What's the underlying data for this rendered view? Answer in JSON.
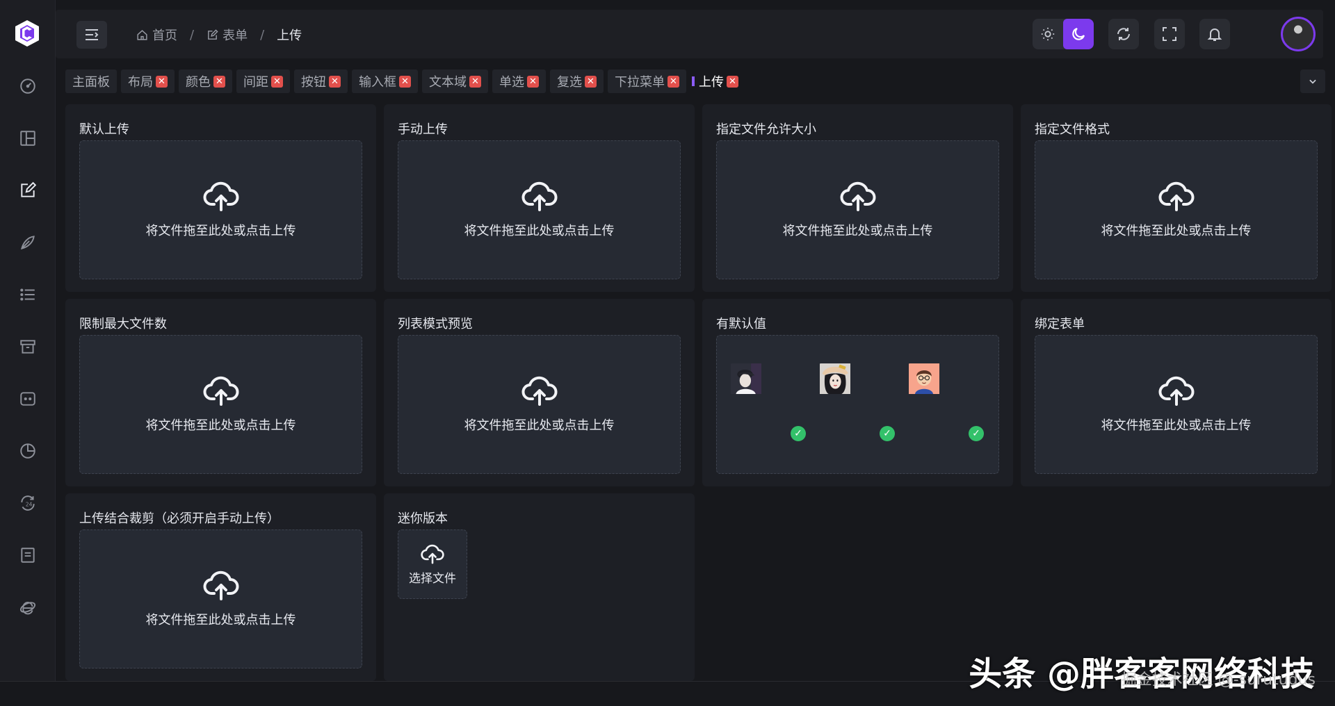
{
  "breadcrumb": [
    {
      "label": "首页",
      "icon": "home-icon"
    },
    {
      "label": "表单",
      "icon": "edit-icon"
    },
    {
      "label": "上传"
    }
  ],
  "tabs": [
    {
      "label": "主面板",
      "closable": false,
      "active": false
    },
    {
      "label": "布局",
      "closable": true,
      "active": false
    },
    {
      "label": "颜色",
      "closable": true,
      "active": false
    },
    {
      "label": "间距",
      "closable": true,
      "active": false
    },
    {
      "label": "按钮",
      "closable": true,
      "active": false
    },
    {
      "label": "输入框",
      "closable": true,
      "active": false
    },
    {
      "label": "文本域",
      "closable": true,
      "active": false
    },
    {
      "label": "单选",
      "closable": true,
      "active": false
    },
    {
      "label": "复选",
      "closable": true,
      "active": false
    },
    {
      "label": "下拉菜单",
      "closable": true,
      "active": false
    },
    {
      "label": "上传",
      "closable": true,
      "active": true
    }
  ],
  "cards": {
    "default": {
      "title": "默认上传",
      "text": "将文件拖至此处或点击上传"
    },
    "manual": {
      "title": "手动上传",
      "text": "将文件拖至此处或点击上传"
    },
    "size": {
      "title": "指定文件允许大小",
      "text": "将文件拖至此处或点击上传"
    },
    "format": {
      "title": "指定文件格式",
      "text": "将文件拖至此处或点击上传"
    },
    "max": {
      "title": "限制最大文件数",
      "text": "将文件拖至此处或点击上传"
    },
    "list": {
      "title": "列表模式预览",
      "text": "将文件拖至此处或点击上传"
    },
    "defaults": {
      "title": "有默认值"
    },
    "form": {
      "title": "绑定表单",
      "text": "将文件拖至此处或点击上传"
    },
    "crop": {
      "title": "上传结合裁剪（必须开启手动上传）",
      "text": "将文件拖至此处或点击上传"
    },
    "mini": {
      "title": "迷你版本",
      "text": "选择文件"
    }
  },
  "watermark": {
    "main": "头条 @胖客客网络科技",
    "sub": "掘金技术社区 @-surutudus"
  },
  "colors": {
    "accent": "#7c3aed",
    "close": "#e2504c",
    "success": "#33c16a"
  }
}
